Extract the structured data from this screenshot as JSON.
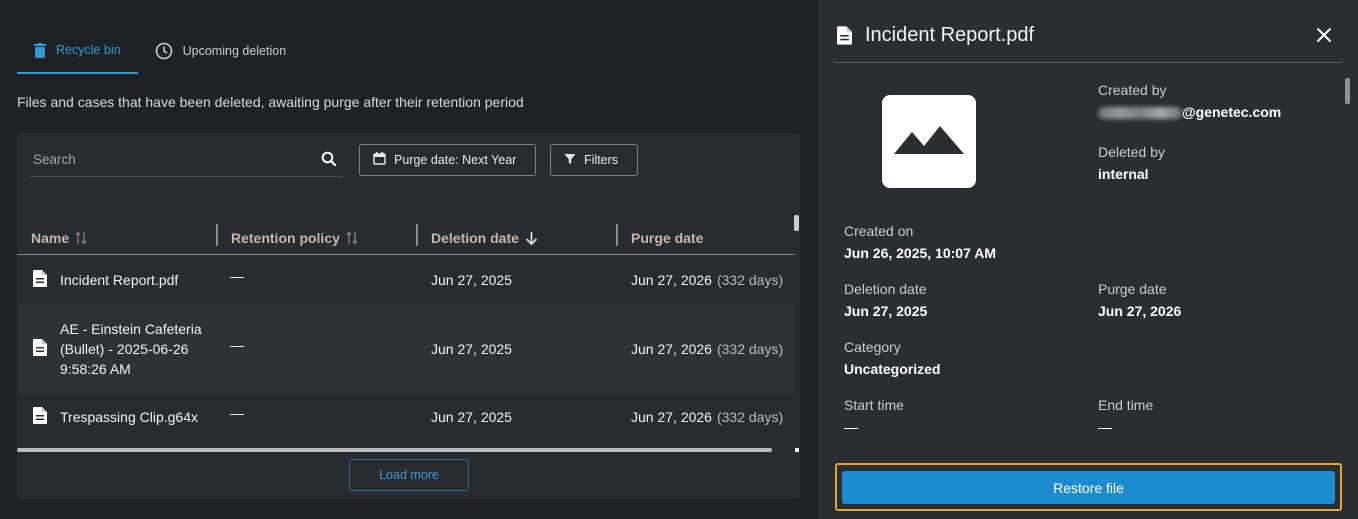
{
  "tabs": [
    {
      "label": "Recycle bin",
      "icon": "trash-icon",
      "active": true
    },
    {
      "label": "Upcoming deletion",
      "icon": "clock-icon",
      "active": false
    }
  ],
  "description": "Files and cases that have been deleted, awaiting purge after their retention period",
  "search": {
    "placeholder": "Search"
  },
  "toolbar": {
    "purge_date_label": "Purge date: Next Year",
    "filters_label": "Filters"
  },
  "table": {
    "columns": [
      "Name",
      "Retention policy",
      "Deletion date",
      "Purge date"
    ],
    "rows": [
      {
        "name": "Incident Report.pdf",
        "retention": "—",
        "deletion": "Jun 27, 2025",
        "purge": "Jun 27, 2026",
        "days": "(332 days)"
      },
      {
        "name_lines": [
          "AE - Einstein Cafeteria",
          "(Bullet) - 2025-06-26",
          "9:58:26 AM"
        ],
        "retention": "—",
        "deletion": "Jun 27, 2025",
        "purge": "Jun 27, 2026",
        "days": "(332 days)"
      },
      {
        "name": "Trespassing Clip.g64x",
        "retention": "—",
        "deletion": "Jun 27, 2025",
        "purge": "Jun 27, 2026",
        "days": "(332 days)"
      }
    ]
  },
  "load_more_label": "Load more",
  "detail": {
    "title": "Incident Report.pdf",
    "created_by_label": "Created by",
    "created_by_value": "@genetec.com",
    "deleted_by_label": "Deleted by",
    "deleted_by_value": "internal",
    "created_on_label": "Created on",
    "created_on_value": "Jun 26, 2025, 10:07 AM",
    "deletion_date_label": "Deletion date",
    "deletion_date_value": "Jun 27, 2025",
    "purge_date_label": "Purge date",
    "purge_date_value": "Jun 27, 2026",
    "category_label": "Category",
    "category_value": "Uncategorized",
    "start_time_label": "Start time",
    "start_time_value": "—",
    "end_time_label": "End time",
    "end_time_value": "—",
    "restore_label": "Restore file"
  },
  "colors": {
    "accent": "#2f9ad6",
    "restore_button": "#1d8ccf",
    "focus_outline": "#e3a72f",
    "column_header": "#c8b5a8"
  }
}
